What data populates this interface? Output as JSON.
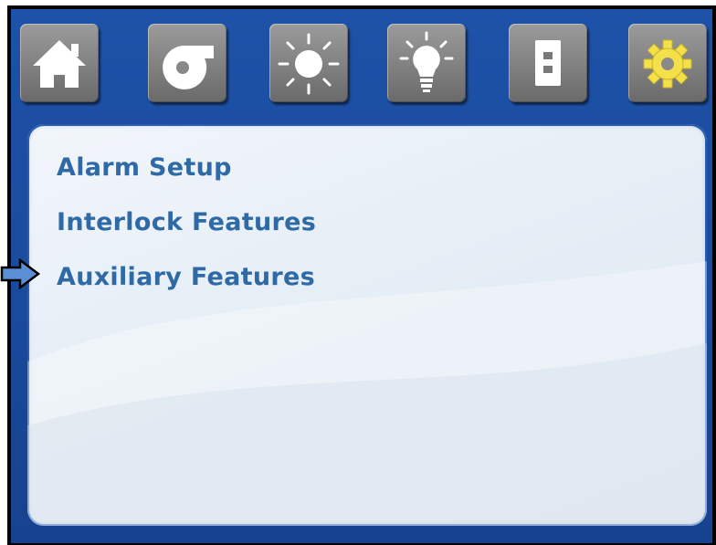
{
  "toolbar": {
    "buttons": [
      {
        "icon": "home-icon"
      },
      {
        "icon": "fan-icon"
      },
      {
        "icon": "sun-icon"
      },
      {
        "icon": "lightbulb-icon"
      },
      {
        "icon": "light-switch-icon"
      },
      {
        "icon": "gear-icon"
      }
    ]
  },
  "menu": {
    "items": [
      {
        "label": "Alarm Setup"
      },
      {
        "label": "Interlock Features"
      },
      {
        "label": "Auxiliary Features"
      }
    ],
    "selected_index": 2
  },
  "colors": {
    "background_blue": "#1a4b9e",
    "menu_text": "#2f6aa6",
    "gear_yellow": "#f4e04a",
    "pointer_arrow": "#5a8fd6"
  }
}
